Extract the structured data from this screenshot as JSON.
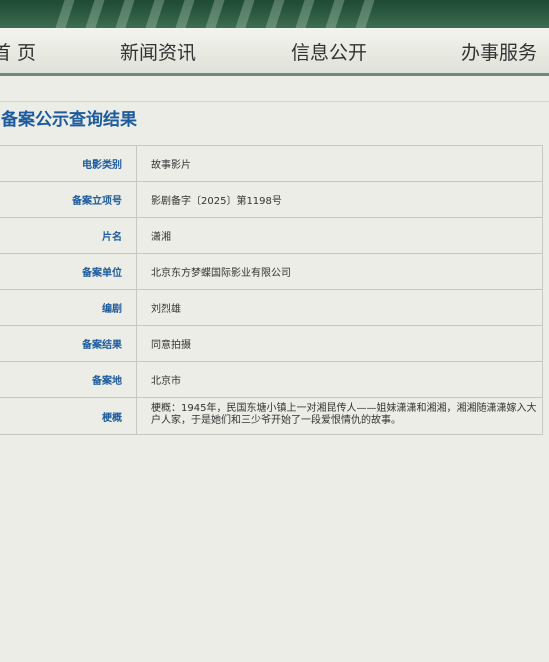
{
  "nav": {
    "items": [
      "首 页",
      "新闻资讯",
      "信息公开",
      "办事服务"
    ]
  },
  "page": {
    "title": "备案公示查询结果"
  },
  "record": {
    "rows": [
      {
        "label": "电影类别",
        "value": "故事影片"
      },
      {
        "label": "备案立项号",
        "value": "影剧备字〔2025〕第1198号"
      },
      {
        "label": "片名",
        "value": "潇湘"
      },
      {
        "label": "备案单位",
        "value": "北京东方梦蝶国际影业有限公司"
      },
      {
        "label": "编剧",
        "value": "刘烈雄"
      },
      {
        "label": "备案结果",
        "value": "同意拍摄"
      },
      {
        "label": "备案地",
        "value": "北京市"
      },
      {
        "label": "梗概",
        "value": "梗概：1945年，民国东塘小镇上一对湘昆传人——姐妹潇潇和湘湘，湘湘随潇潇嫁入大户人家，于是她们和三少爷开始了一段爱恨情仇的故事。"
      }
    ]
  },
  "colors": {
    "accent": "#1d5b9e",
    "banner": "#2f5e45",
    "background": "#ecede6"
  }
}
